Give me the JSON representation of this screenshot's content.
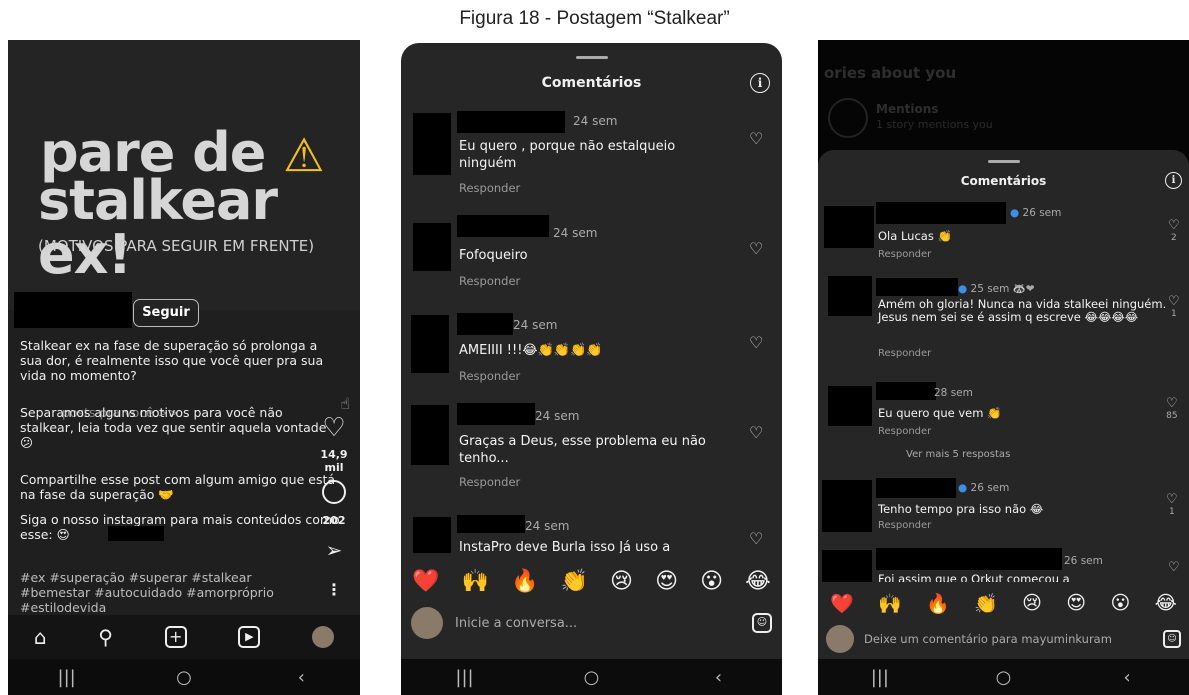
{
  "figure_title": "Figura 18 - Postagem “Stalkear”",
  "post": {
    "headline_line1": "pare de",
    "headline_line2": "stalkear ex!",
    "warning_glyph": "⚠",
    "subheadline": "(MOTIVOS PARA SEGUIR EM FRENTE)",
    "follow_label": "Seguir",
    "caption": [
      "Stalkear ex na fase de superação só prolonga a sua dor, é realmente isso que você quer pra sua vida no momento?",
      "Separamos alguns motivos para você não stalkear, leia toda vez que sentir aquela vontade 😕",
      "Compartilhe esse post com algum amigo que está na fase da superação 🤝",
      "Siga o nosso instagram para mais conteúdos como esse: 😍",
      "#ex #superação #superar #stalkear #bemestar #autocuidado #amorpróprio #estilodevida"
    ],
    "overlay_text": "posts pra você >>",
    "likes": "14,9 mil",
    "comments": "202"
  },
  "comments_panel": {
    "title": "Comentários",
    "info_icon": "i",
    "comments": [
      {
        "time": "24 sem",
        "text": "Eu quero , porque não  estalqueio ninguém",
        "reply": "Responder"
      },
      {
        "time": "24 sem",
        "text": "Fofoqueiro",
        "reply": "Responder"
      },
      {
        "time": "24 sem",
        "text": "AMEIIII !!!😂👏👏👏👏",
        "reply": "Responder"
      },
      {
        "time": "24 sem",
        "text": "Graças a Deus, esse problema eu não tenho...",
        "reply": "Responder"
      },
      {
        "time": "24 sem",
        "text": "InstaPro   deve Burla isso   Já uso a",
        "reply": ""
      }
    ],
    "emojis": [
      "❤️",
      "🙌",
      "🔥",
      "👏",
      "😢",
      "😍",
      "😮",
      "😂"
    ],
    "input_placeholder": "Inicie a conversa..."
  },
  "stories_panel": {
    "bg_title": "ories about you",
    "mentions_title": "Mentions",
    "mentions_sub": "1 story mentions you",
    "title": "Comentários",
    "comments": [
      {
        "time": "26 sem",
        "text": "Ola Lucas 👏",
        "reply": "Responder",
        "likes": "2"
      },
      {
        "time": "25 sem 🦝❤",
        "text": "Amém oh gloria! Nunca na vida stalkeei ninguém. Jesus nem sei se é assim q escreve 😂😂😂😂",
        "reply": "Responder",
        "likes": "1"
      },
      {
        "time": "28 sem",
        "text": "Eu quero que vem 👏",
        "reply": "Responder",
        "likes": "85"
      },
      {
        "time": "26 sem",
        "text": "Tenho tempo pra isso não 😂",
        "reply": "Responder",
        "likes": "1"
      },
      {
        "time": "26 sem",
        "text": "Foi assim que o Orkut começou a",
        "reply": "",
        "likes": ""
      }
    ],
    "more_replies": "Ver mais 5 respostas",
    "emojis": [
      "❤️",
      "🙌",
      "🔥",
      "👏",
      "😢",
      "😍",
      "😮",
      "😂"
    ],
    "input_placeholder": "Deixe um comentário para mayuminkuram"
  },
  "system_nav": {
    "recent": "|||",
    "home": "○",
    "back": "‹"
  }
}
